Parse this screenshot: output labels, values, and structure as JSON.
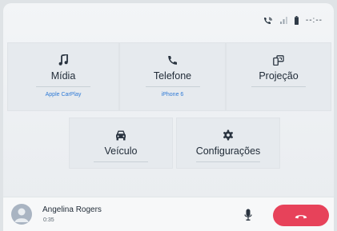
{
  "status_bar": {
    "time": "--:--",
    "icons": [
      "phone-wifi-icon",
      "signal-icon",
      "battery-icon"
    ]
  },
  "tiles": [
    {
      "id": "midia",
      "label": "Mídia",
      "sublabel": "Apple CarPlay",
      "icon": "music-note-icon"
    },
    {
      "id": "telefone",
      "label": "Telefone",
      "sublabel": "iPhone 6",
      "icon": "phone-icon"
    },
    {
      "id": "projecao",
      "label": "Projeção",
      "sublabel": "",
      "icon": "projection-icon"
    },
    {
      "id": "veiculo",
      "label": "Veículo",
      "sublabel": "",
      "icon": "car-icon"
    },
    {
      "id": "configuracoes",
      "label": "Configurações",
      "sublabel": "",
      "icon": "gear-icon"
    }
  ],
  "call": {
    "caller_name": "Angelina Rogers",
    "duration": "0:35",
    "mic_icon": "microphone-icon",
    "hangup_icon": "hang-up-icon"
  },
  "colors": {
    "accent_blue": "#2f7ad6",
    "hangup_red": "#e7425a",
    "text_dark": "#1f2a36"
  }
}
